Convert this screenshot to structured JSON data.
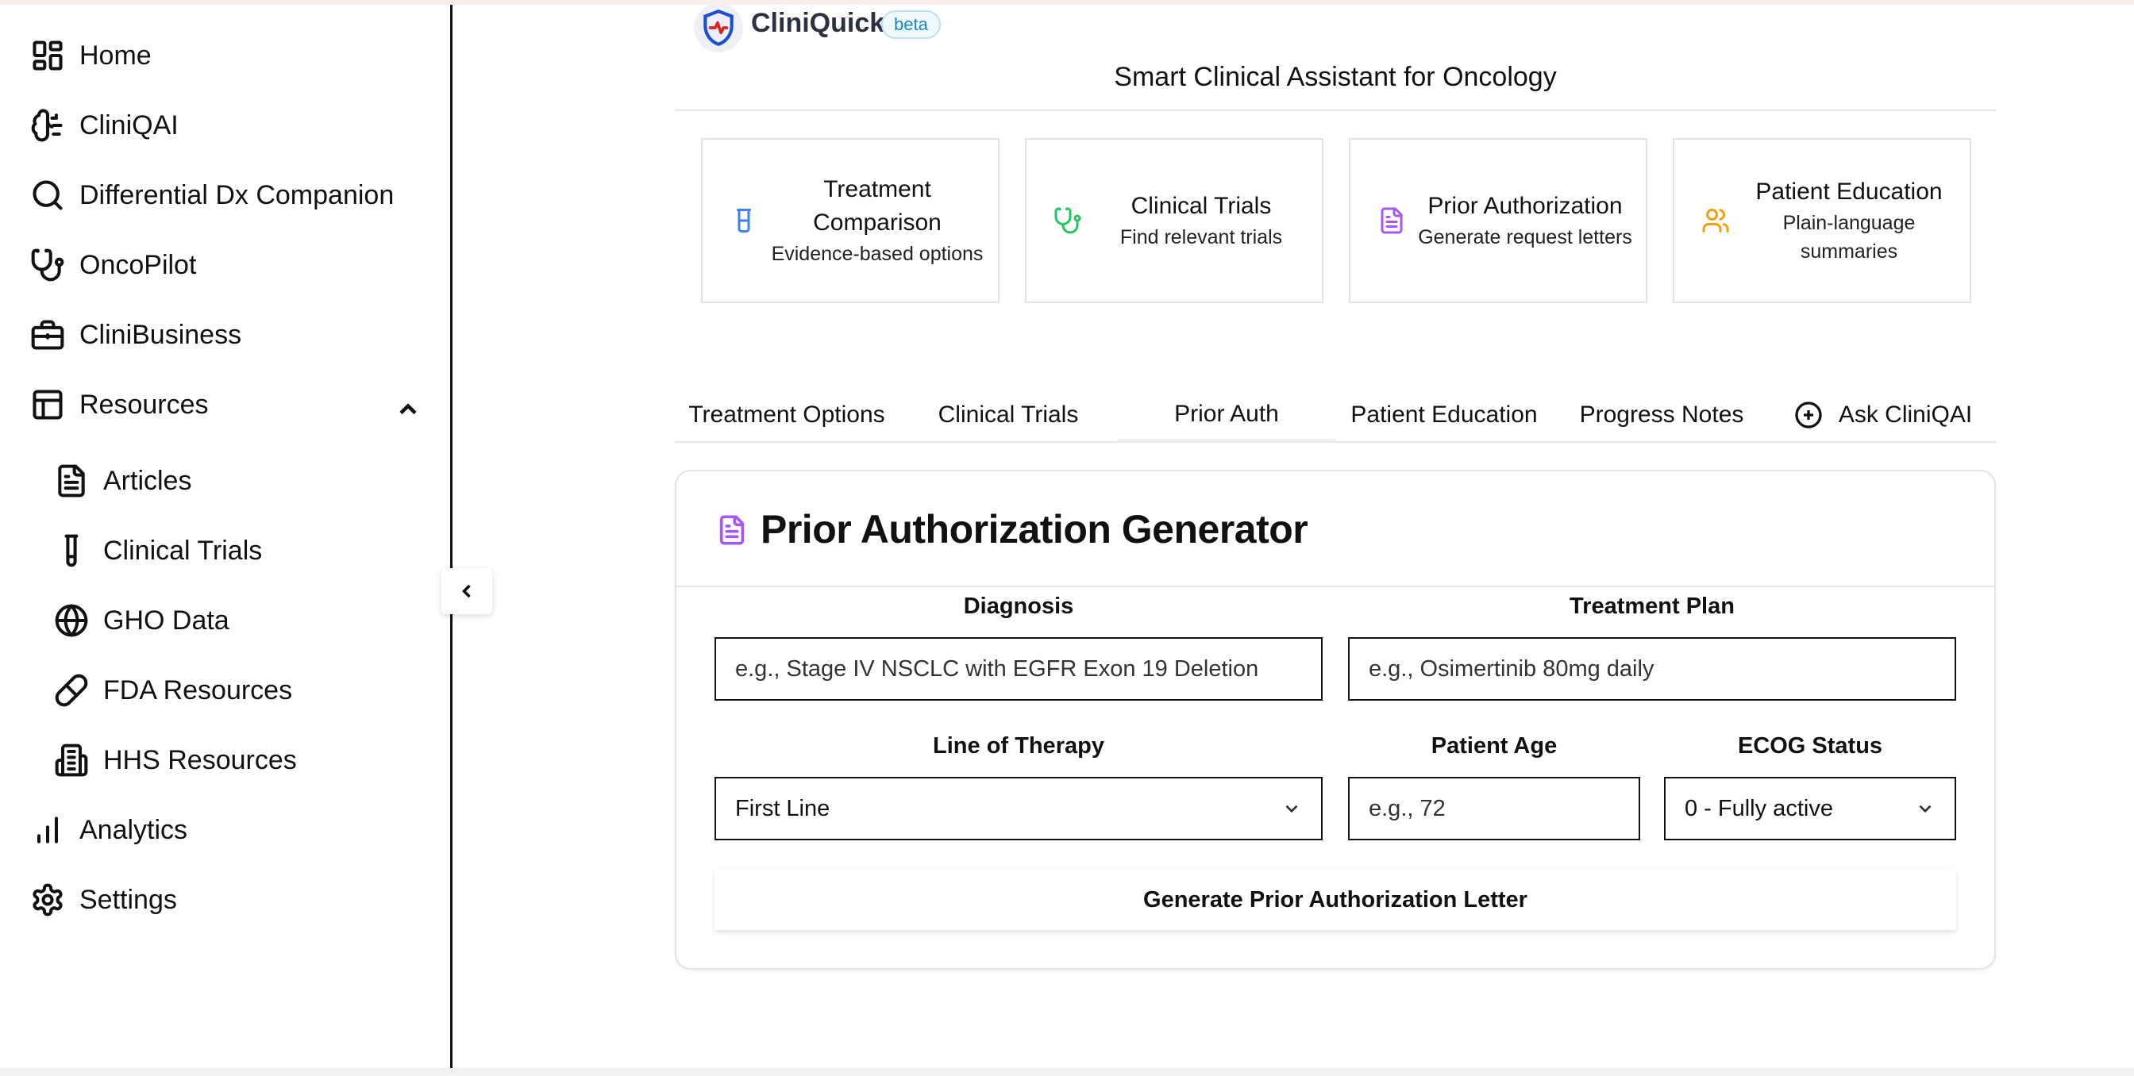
{
  "sidebar": {
    "items": [
      {
        "label": "Home",
        "icon": "grid-icon"
      },
      {
        "label": "CliniQAI",
        "icon": "brain-icon"
      },
      {
        "label": "Differential Dx Companion",
        "icon": "search-icon"
      },
      {
        "label": "OncoPilot",
        "icon": "stethoscope-icon"
      },
      {
        "label": "CliniBusiness",
        "icon": "briefcase-icon"
      },
      {
        "label": "Resources",
        "icon": "layout-icon",
        "expanded": true
      },
      {
        "label": "Analytics",
        "icon": "bar-chart-icon"
      },
      {
        "label": "Settings",
        "icon": "gear-icon"
      }
    ],
    "resources": [
      {
        "label": "Articles",
        "icon": "file-text-icon"
      },
      {
        "label": "Clinical Trials",
        "icon": "test-tube-icon"
      },
      {
        "label": "GHO Data",
        "icon": "globe-icon"
      },
      {
        "label": "FDA Resources",
        "icon": "pill-icon"
      },
      {
        "label": "HHS Resources",
        "icon": "building-icon"
      }
    ]
  },
  "header": {
    "brand": "CliniQuick",
    "badge": "beta",
    "subtitle": "Smart Clinical Assistant for Oncology"
  },
  "cards": [
    {
      "title": "Treatment Comparison",
      "desc": "Evidence-based options",
      "icon": "beaker-icon",
      "color": "#3b82f6"
    },
    {
      "title": "Clinical Trials",
      "desc": "Find relevant trials",
      "icon": "stethoscope-icon",
      "color": "#22c55e"
    },
    {
      "title": "Prior Authorization",
      "desc": "Generate request letters",
      "icon": "file-text-icon",
      "color": "#a855f7"
    },
    {
      "title": "Patient Education",
      "desc": "Plain-language summaries",
      "icon": "users-icon",
      "color": "#f59e0b"
    }
  ],
  "tabs": [
    {
      "label": "Treatment Options"
    },
    {
      "label": "Clinical Trials"
    },
    {
      "label": "Prior Auth",
      "active": true
    },
    {
      "label": "Patient Education"
    },
    {
      "label": "Progress Notes"
    },
    {
      "label": "Ask CliniQAI",
      "icon": "plus-circle-icon"
    }
  ],
  "form": {
    "title": "Prior Authorization Generator",
    "diagnosis": {
      "label": "Diagnosis",
      "placeholder": "e.g., Stage IV NSCLC with EGFR Exon 19 Deletion"
    },
    "treatment_plan": {
      "label": "Treatment Plan",
      "placeholder": "e.g., Osimertinib 80mg daily"
    },
    "line_of_therapy": {
      "label": "Line of Therapy",
      "value": "First Line"
    },
    "patient_age": {
      "label": "Patient Age",
      "placeholder": "e.g., 72"
    },
    "ecog_status": {
      "label": "ECOG Status",
      "value": "0 - Fully active"
    },
    "submit_label": "Generate Prior Authorization Letter"
  }
}
